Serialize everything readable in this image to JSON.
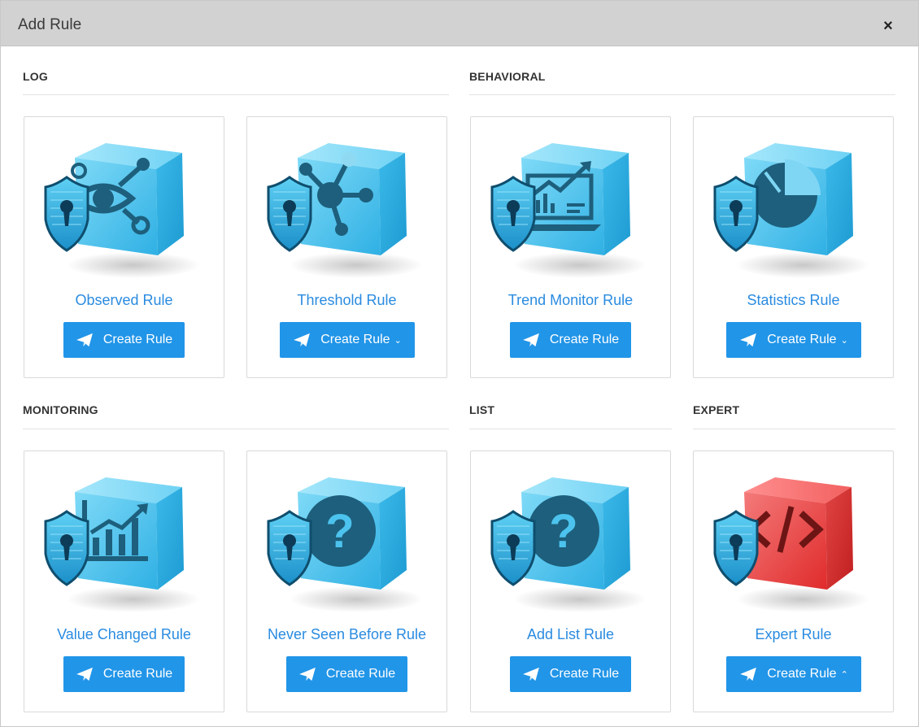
{
  "modal": {
    "title": "Add Rule",
    "close_label": "×"
  },
  "sections": {
    "log": "LOG",
    "behavioral": "BEHAVIORAL",
    "monitoring": "MONITORING",
    "list": "LIST",
    "expert": "EXPERT"
  },
  "cards": [
    {
      "title": "Observed Rule",
      "button": "Create Rule",
      "caret": "",
      "icon": "eye-network-icon"
    },
    {
      "title": "Threshold Rule",
      "button": "Create Rule",
      "caret": "⌄",
      "icon": "network-node-icon"
    },
    {
      "title": "Trend Monitor Rule",
      "button": "Create Rule",
      "caret": "",
      "icon": "laptop-trend-icon"
    },
    {
      "title": "Statistics Rule",
      "button": "Create Rule",
      "caret": "⌄",
      "icon": "pie-chart-icon"
    },
    {
      "title": "Value Changed Rule",
      "button": "Create Rule",
      "caret": "",
      "icon": "bar-growth-icon"
    },
    {
      "title": "Never Seen Before Rule",
      "button": "Create Rule",
      "caret": "",
      "icon": "question-icon"
    },
    {
      "title": "Add List Rule",
      "button": "Create Rule",
      "caret": "",
      "icon": "question-icon"
    },
    {
      "title": "Expert Rule",
      "button": "Create Rule",
      "caret": "⌃",
      "icon": "code-icon"
    }
  ],
  "colors": {
    "accent": "#2195e8",
    "title": "#2a8be0",
    "cube_blue": "#4cc3ee",
    "cube_red": "#e53b3b"
  }
}
